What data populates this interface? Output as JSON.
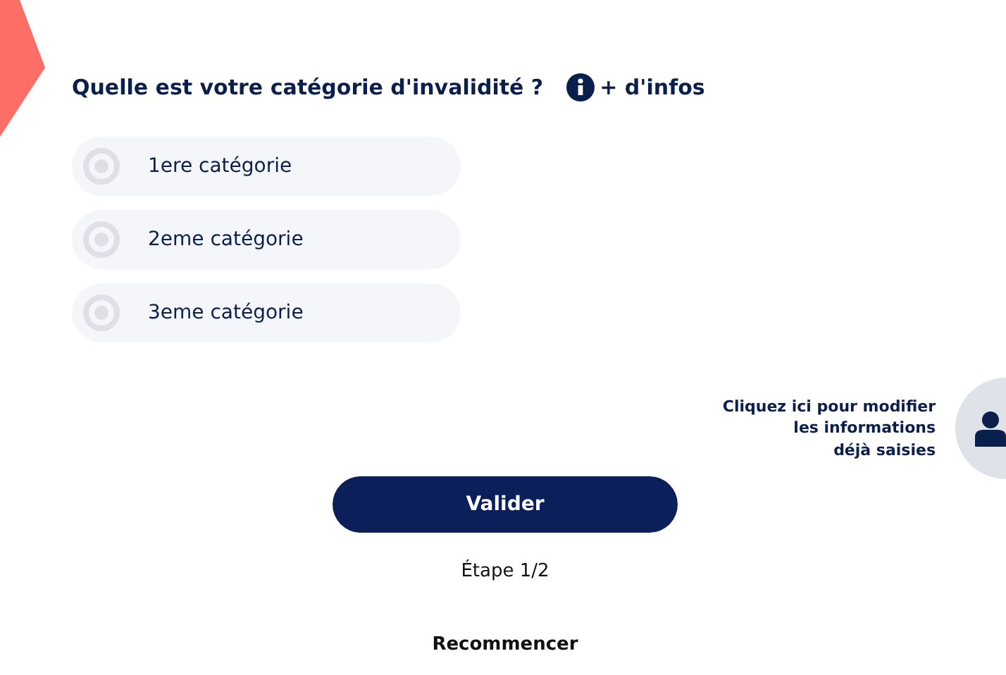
{
  "question": {
    "title": "Quelle est votre catégorie d'invalidité ?",
    "info_link": "+ d'infos"
  },
  "options": [
    {
      "label": "1ere catégorie",
      "selected": false
    },
    {
      "label": "2eme catégorie",
      "selected": false
    },
    {
      "label": "3eme catégorie",
      "selected": false
    }
  ],
  "side_help": {
    "lines": [
      "Cliquez ici pour modifier",
      "les informations",
      "déjà saisies"
    ]
  },
  "submit": "Valider",
  "step": "Étape 1/2",
  "restart": "Recommencer"
}
